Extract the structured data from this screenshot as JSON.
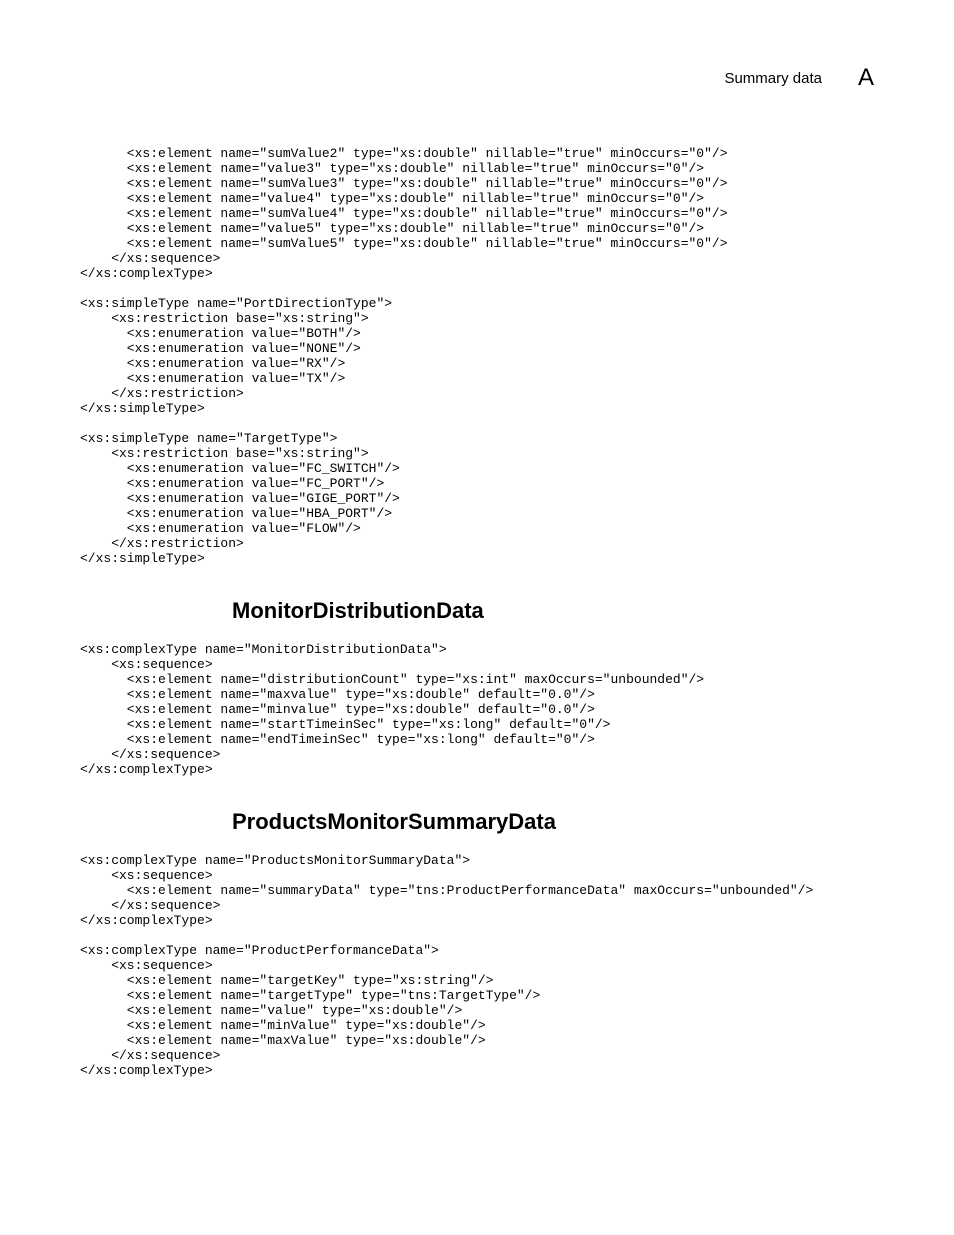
{
  "header": {
    "title": "Summary data",
    "letter": "A"
  },
  "code_block_1": "      <xs:element name=\"sumValue2\" type=\"xs:double\" nillable=\"true\" minOccurs=\"0\"/>\n      <xs:element name=\"value3\" type=\"xs:double\" nillable=\"true\" minOccurs=\"0\"/>\n      <xs:element name=\"sumValue3\" type=\"xs:double\" nillable=\"true\" minOccurs=\"0\"/>\n      <xs:element name=\"value4\" type=\"xs:double\" nillable=\"true\" minOccurs=\"0\"/>\n      <xs:element name=\"sumValue4\" type=\"xs:double\" nillable=\"true\" minOccurs=\"0\"/>\n      <xs:element name=\"value5\" type=\"xs:double\" nillable=\"true\" minOccurs=\"0\"/>\n      <xs:element name=\"sumValue5\" type=\"xs:double\" nillable=\"true\" minOccurs=\"0\"/>\n    </xs:sequence>\n</xs:complexType>\n\n<xs:simpleType name=\"PortDirectionType\">\n    <xs:restriction base=\"xs:string\">\n      <xs:enumeration value=\"BOTH\"/>\n      <xs:enumeration value=\"NONE\"/>\n      <xs:enumeration value=\"RX\"/>\n      <xs:enumeration value=\"TX\"/>\n    </xs:restriction>\n</xs:simpleType>\n\n<xs:simpleType name=\"TargetType\">\n    <xs:restriction base=\"xs:string\">\n      <xs:enumeration value=\"FC_SWITCH\"/>\n      <xs:enumeration value=\"FC_PORT\"/>\n      <xs:enumeration value=\"GIGE_PORT\"/>\n      <xs:enumeration value=\"HBA_PORT\"/>\n      <xs:enumeration value=\"FLOW\"/>\n    </xs:restriction>\n</xs:simpleType>",
  "heading_1": "MonitorDistributionData",
  "code_block_2": "<xs:complexType name=\"MonitorDistributionData\">\n    <xs:sequence>\n      <xs:element name=\"distributionCount\" type=\"xs:int\" maxOccurs=\"unbounded\"/>\n      <xs:element name=\"maxvalue\" type=\"xs:double\" default=\"0.0\"/>\n      <xs:element name=\"minvalue\" type=\"xs:double\" default=\"0.0\"/>\n      <xs:element name=\"startTimeinSec\" type=\"xs:long\" default=\"0\"/>\n      <xs:element name=\"endTimeinSec\" type=\"xs:long\" default=\"0\"/>\n    </xs:sequence>\n</xs:complexType>",
  "heading_2": "ProductsMonitorSummaryData",
  "code_block_3": "<xs:complexType name=\"ProductsMonitorSummaryData\">\n    <xs:sequence>\n      <xs:element name=\"summaryData\" type=\"tns:ProductPerformanceData\" maxOccurs=\"unbounded\"/>\n    </xs:sequence>\n</xs:complexType>\n\n<xs:complexType name=\"ProductPerformanceData\">\n    <xs:sequence>\n      <xs:element name=\"targetKey\" type=\"xs:string\"/>\n      <xs:element name=\"targetType\" type=\"tns:TargetType\"/>\n      <xs:element name=\"value\" type=\"xs:double\"/>\n      <xs:element name=\"minValue\" type=\"xs:double\"/>\n      <xs:element name=\"maxValue\" type=\"xs:double\"/>\n    </xs:sequence>\n</xs:complexType>"
}
